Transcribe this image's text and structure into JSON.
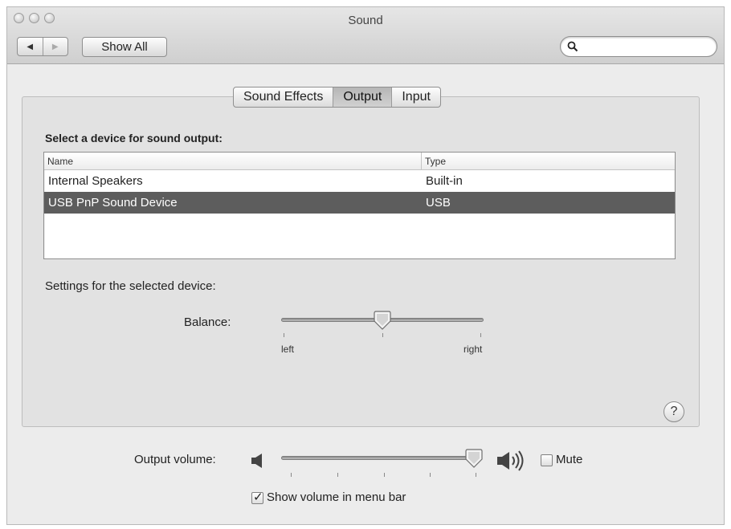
{
  "window": {
    "title": "Sound"
  },
  "toolbar": {
    "back_glyph": "◀",
    "forward_glyph": "▶",
    "show_all_label": "Show All",
    "search_placeholder": ""
  },
  "tabs": [
    {
      "label": "Sound Effects",
      "active": false
    },
    {
      "label": "Output",
      "active": true
    },
    {
      "label": "Input",
      "active": false
    }
  ],
  "output": {
    "select_prompt": "Select a device for sound output:",
    "table": {
      "columns": [
        "Name",
        "Type"
      ],
      "rows": [
        {
          "name": "Internal Speakers",
          "type": "Built-in",
          "selected": false
        },
        {
          "name": "USB PnP Sound Device",
          "type": "USB",
          "selected": true
        }
      ]
    },
    "settings_label": "Settings for the selected device:",
    "balance": {
      "label": "Balance:",
      "left_label": "left",
      "right_label": "right",
      "value": 0.5
    },
    "help_glyph": "?"
  },
  "volume": {
    "label": "Output volume:",
    "value": 0.97,
    "mute_label": "Mute",
    "mute_checked": false,
    "show_in_menu_bar_label": "Show volume in menu bar",
    "show_in_menu_bar_checked": true
  }
}
